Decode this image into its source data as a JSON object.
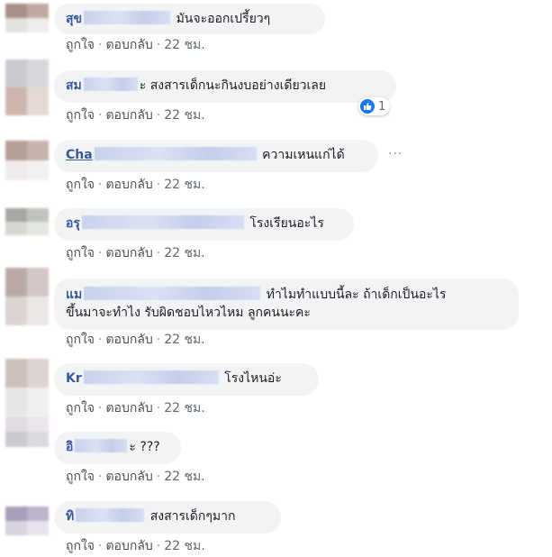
{
  "actions": {
    "like": "ถูกใจ",
    "reply": "ตอบกลับ",
    "separator": "·",
    "time": "22 ชม."
  },
  "comments": [
    {
      "name": "สุข",
      "text": "มันจะออกเปรี้ยวๆ"
    },
    {
      "name": "สม",
      "text": "ะ สงสารเด็กนะกินงบอย่างเดียวเลย",
      "reactions": "1"
    },
    {
      "name": "Cha",
      "text": "ความเหนแก่ได้"
    },
    {
      "name": "อรุ",
      "text": "โรงเรียนอะไร"
    },
    {
      "name": "แม",
      "text": "ทำไมทำแบบนี้ละ ถ้าเด็กเป็นอะไร",
      "text_line2": "ขึ้นมาจะทำไง รับผิดชอบไหวไหม ลูกคนนะคะ"
    },
    {
      "name": "Kr",
      "text": "โรงไหนอ่ะ"
    },
    {
      "name": "อิ",
      "text": "ะ ???"
    },
    {
      "name": "ทิ",
      "text": "สงสารเด็กๆมาก"
    }
  ],
  "colors": {
    "link": "#385898",
    "bubble": "#f2f3f5",
    "like": "#1877f2"
  }
}
